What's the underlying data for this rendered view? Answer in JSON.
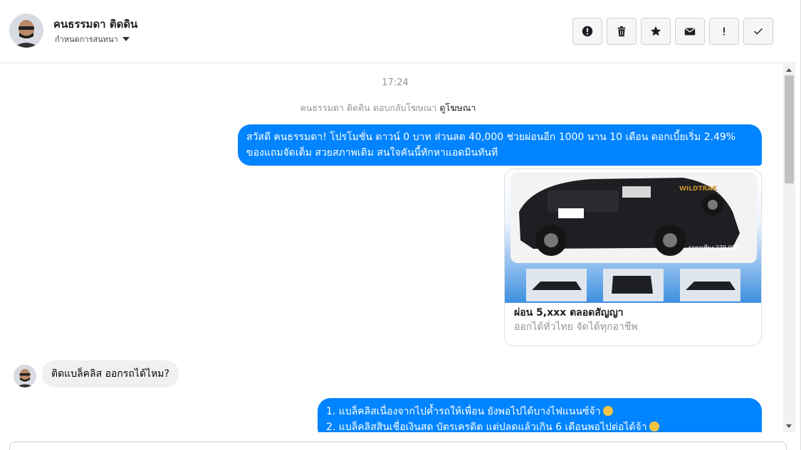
{
  "header": {
    "contact_name": "คนธรรมดา ติดดิน",
    "assign_label": "กำหนดการสนทนา",
    "actions": [
      "alert-circle-icon",
      "trash-icon",
      "star-icon",
      "envelope-icon",
      "exclamation-icon",
      "check-icon"
    ]
  },
  "chat": {
    "time": "17:24",
    "notice_text": "คนธรรมดา ติดดิน ตอบกลับโฆษณา",
    "notice_link": "ดูโฆษณา",
    "message_out_1": "สวัสดี คนธรรมดา! โปรโมชั่น ดาวน์ 0 บาท ส่วนลด 40,000 ช่วยผ่อนอีก 1000 นาน 10 เดือน ดอกเบี้ยเริ่ม 2.49% ของแถมจัดเต็ม สวยสภาพเดิม สนใจคันนี้ทักหาแอดมินทันที",
    "card": {
      "title": "ผ่อน 5,xxx ตลอดสัญญา",
      "subtitle": "ออกได้ทั่วไทย จัดได้ทุกอาชีพ",
      "image_price": "ราคาเพียง 279,000.-",
      "image_badge": "WILDTRAK"
    },
    "message_in_1": "ติดแบล็คลิส ออกรถได้ไหม?",
    "message_out_2_line1": "1. แบล็คลิสเนื่องจากไปค้ำรถให้เพื่อน ยังพอไปได้บางไฟแนนซ์จ้า",
    "message_out_2_line2": "2. แบล็คลิสสินเชื่อเงินสด บัตรเครดิต แต่ปลดแล้วเกิน 6 เดือนพอไปต่อได้จ้า"
  },
  "colors": {
    "outgoing_bubble": "#0084ff",
    "incoming_bubble": "#f1f0f0"
  }
}
